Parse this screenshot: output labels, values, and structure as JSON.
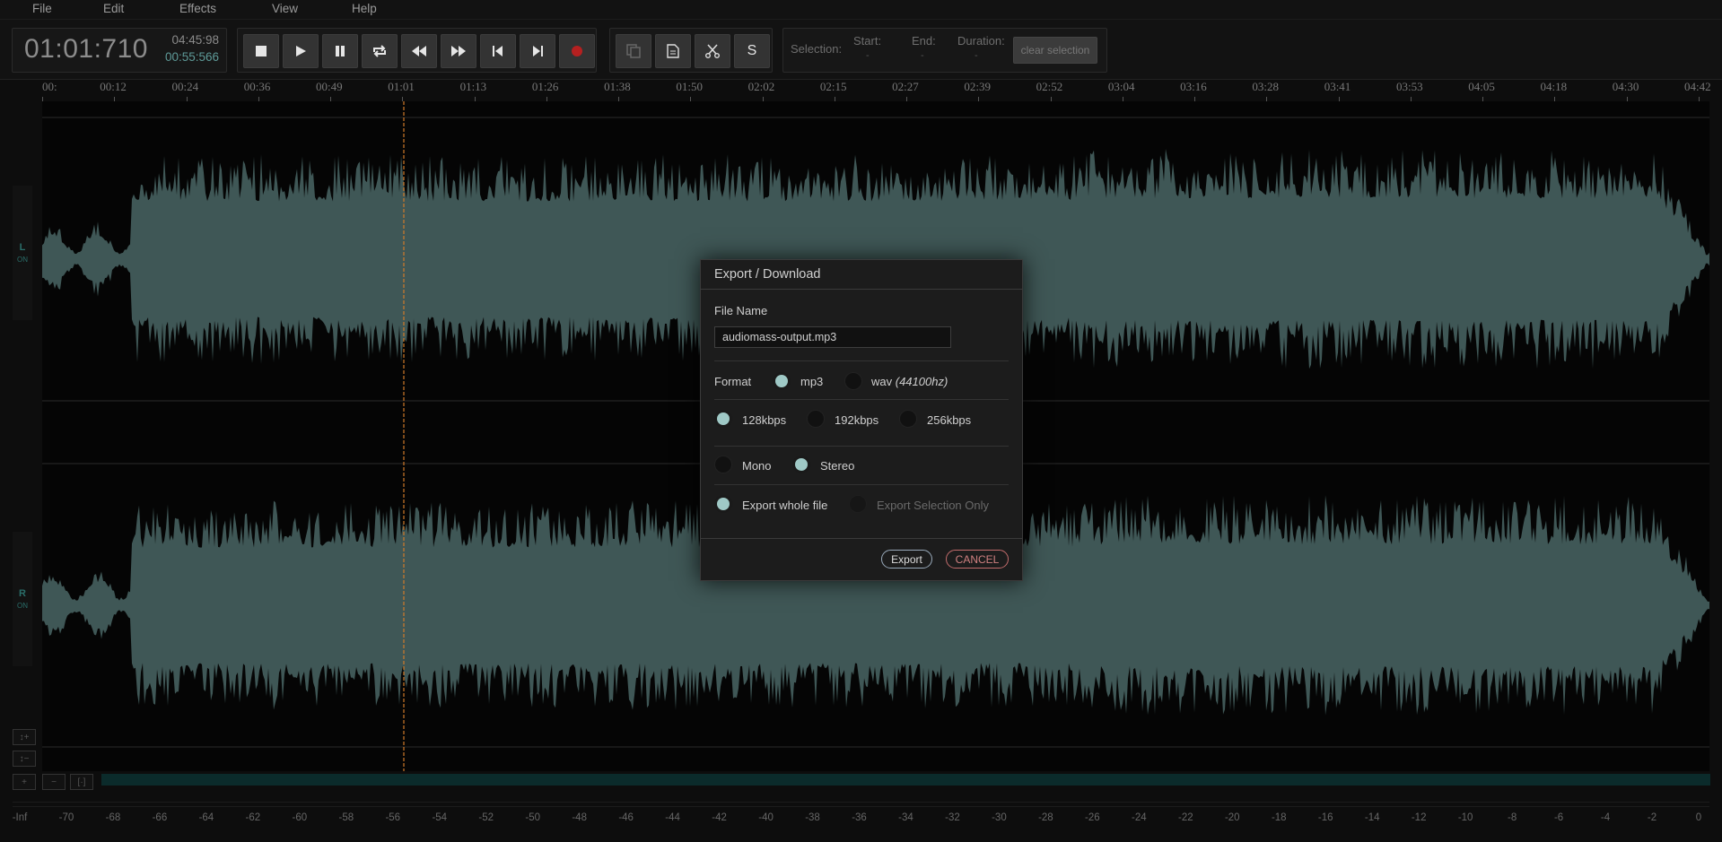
{
  "menu": [
    "File",
    "Edit",
    "Effects",
    "View",
    "Help"
  ],
  "time": {
    "current": "01:01:710",
    "total": "04:45:98",
    "selection_time": "00:55:566"
  },
  "transport": {
    "buttons": [
      "stop-icon",
      "play-icon",
      "pause-icon",
      "loop-icon",
      "rewind-icon",
      "fast-forward-icon",
      "skip-back-icon",
      "skip-forward-icon",
      "record-icon"
    ],
    "record_color": "#b52020"
  },
  "edit_tools": {
    "buttons": [
      "copy-icon",
      "paste-icon",
      "cut-icon",
      "silence-icon"
    ],
    "silence_label": "S"
  },
  "selection": {
    "label": "Selection:",
    "start_label": "Start:",
    "start_value": "-",
    "end_label": "End:",
    "end_value": "-",
    "duration_label": "Duration:",
    "duration_value": "-",
    "clear_label": "clear selection"
  },
  "timeline_ticks": [
    "00:",
    "00:12",
    "00:24",
    "00:36",
    "00:49",
    "01:01",
    "01:13",
    "01:26",
    "01:38",
    "01:50",
    "02:02",
    "02:15",
    "02:27",
    "02:39",
    "02:52",
    "03:04",
    "03:16",
    "03:28",
    "03:41",
    "03:53",
    "04:05",
    "04:18",
    "04:30",
    "04:42"
  ],
  "channels": [
    {
      "name": "L",
      "state": "ON"
    },
    {
      "name": "R",
      "state": "ON"
    }
  ],
  "zoom_buttons": {
    "vzoom_in": "↕+",
    "vzoom_out": "↕−",
    "hzoom_in": "+",
    "hzoom_out": "−",
    "fit": "[·]"
  },
  "playhead_color": "#d07a2a",
  "waveform_color": "#3f5756",
  "db_scale": [
    "-Inf",
    "-70",
    "-68",
    "-66",
    "-64",
    "-62",
    "-60",
    "-58",
    "-56",
    "-54",
    "-52",
    "-50",
    "-48",
    "-46",
    "-44",
    "-42",
    "-40",
    "-38",
    "-36",
    "-34",
    "-32",
    "-30",
    "-28",
    "-26",
    "-24",
    "-22",
    "-20",
    "-18",
    "-16",
    "-14",
    "-12",
    "-10",
    "-8",
    "-6",
    "-4",
    "-2",
    "0"
  ],
  "dialog": {
    "title": "Export / Download",
    "filename_label": "File Name",
    "filename_value": "audiomass-output.mp3",
    "format_label": "Format",
    "format_options": [
      {
        "label": "mp3",
        "selected": true
      },
      {
        "label": "wav",
        "suffix": "(44100hz)",
        "selected": false
      }
    ],
    "bitrate_options": [
      {
        "label": "128kbps",
        "selected": true
      },
      {
        "label": "192kbps",
        "selected": false
      },
      {
        "label": "256kbps",
        "selected": false
      }
    ],
    "channel_options": [
      {
        "label": "Mono",
        "selected": false
      },
      {
        "label": "Stereo",
        "selected": true
      }
    ],
    "scope_options": [
      {
        "label": "Export whole file",
        "selected": true
      },
      {
        "label": "Export Selection Only",
        "selected": false,
        "disabled": true
      }
    ],
    "export_label": "Export",
    "cancel_label": "CANCEL"
  }
}
